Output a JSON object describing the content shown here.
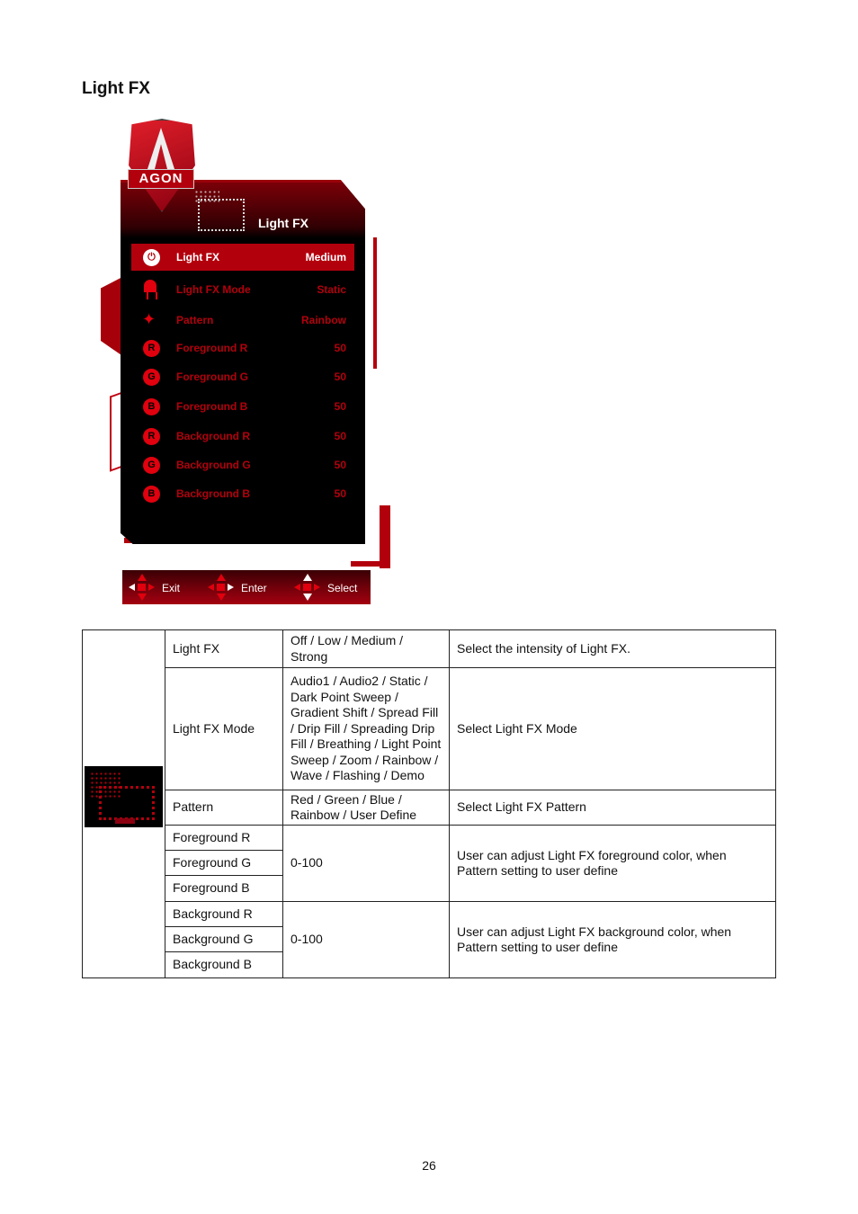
{
  "section_title": "Light FX",
  "osd": {
    "logo": "AGON",
    "header_title": "Light FX",
    "rows": [
      {
        "icon": "power-icon",
        "glyph": "⏻",
        "label": "Light FX",
        "value": "Medium",
        "selected": true
      },
      {
        "icon": "bulb-icon",
        "glyph": "",
        "label": "Light FX Mode",
        "value": "Static"
      },
      {
        "icon": "sparkle-icon",
        "glyph": "✦",
        "label": "Pattern",
        "value": "Rainbow"
      },
      {
        "icon": "r-circle-icon",
        "glyph": "R",
        "label": "Foreground R",
        "value": "50"
      },
      {
        "icon": "g-circle-icon",
        "glyph": "G",
        "label": "Foreground G",
        "value": "50"
      },
      {
        "icon": "b-circle-icon",
        "glyph": "B",
        "label": "Foreground B",
        "value": "50"
      },
      {
        "icon": "r-circle-icon",
        "glyph": "R",
        "label": "Background R",
        "value": "50"
      },
      {
        "icon": "g-circle-icon",
        "glyph": "G",
        "label": "Background G",
        "value": "50"
      },
      {
        "icon": "b-circle-icon",
        "glyph": "B",
        "label": "Background B",
        "value": "50"
      }
    ],
    "footer": {
      "exit": "Exit",
      "enter": "Enter",
      "select": "Select"
    },
    "colors": {
      "accent": "#b3000d",
      "bright": "#e0000e"
    }
  },
  "table": {
    "rows": [
      {
        "item": "Light FX",
        "options": "Off / Low / Medium / Strong",
        "description": "Select the intensity of Light FX."
      },
      {
        "item": "Light FX Mode",
        "options": "Audio1 / Audio2 / Static / Dark Point Sweep / Gradient Shift / Spread Fill / Drip Fill / Spreading Drip Fill / Breathing / Light Point Sweep / Zoom / Rainbow / Wave / Flashing / Demo",
        "description": "Select Light FX Mode"
      },
      {
        "item": "Pattern",
        "options": "Red  / Green  / Blue  / Rainbow / User Define",
        "description": "Select Light FX Pattern"
      },
      {
        "item": "Foreground R",
        "options": "0-100",
        "description": "User can adjust Light FX foreground color, when Pattern setting to user define"
      },
      {
        "item": "Foreground G"
      },
      {
        "item": "Foreground B"
      },
      {
        "item": "Background R",
        "options": "0-100",
        "description": "User can adjust Light FX background color, when Pattern setting to user define"
      },
      {
        "item": "Background G"
      },
      {
        "item": "Background B"
      }
    ]
  },
  "page_number": "26"
}
